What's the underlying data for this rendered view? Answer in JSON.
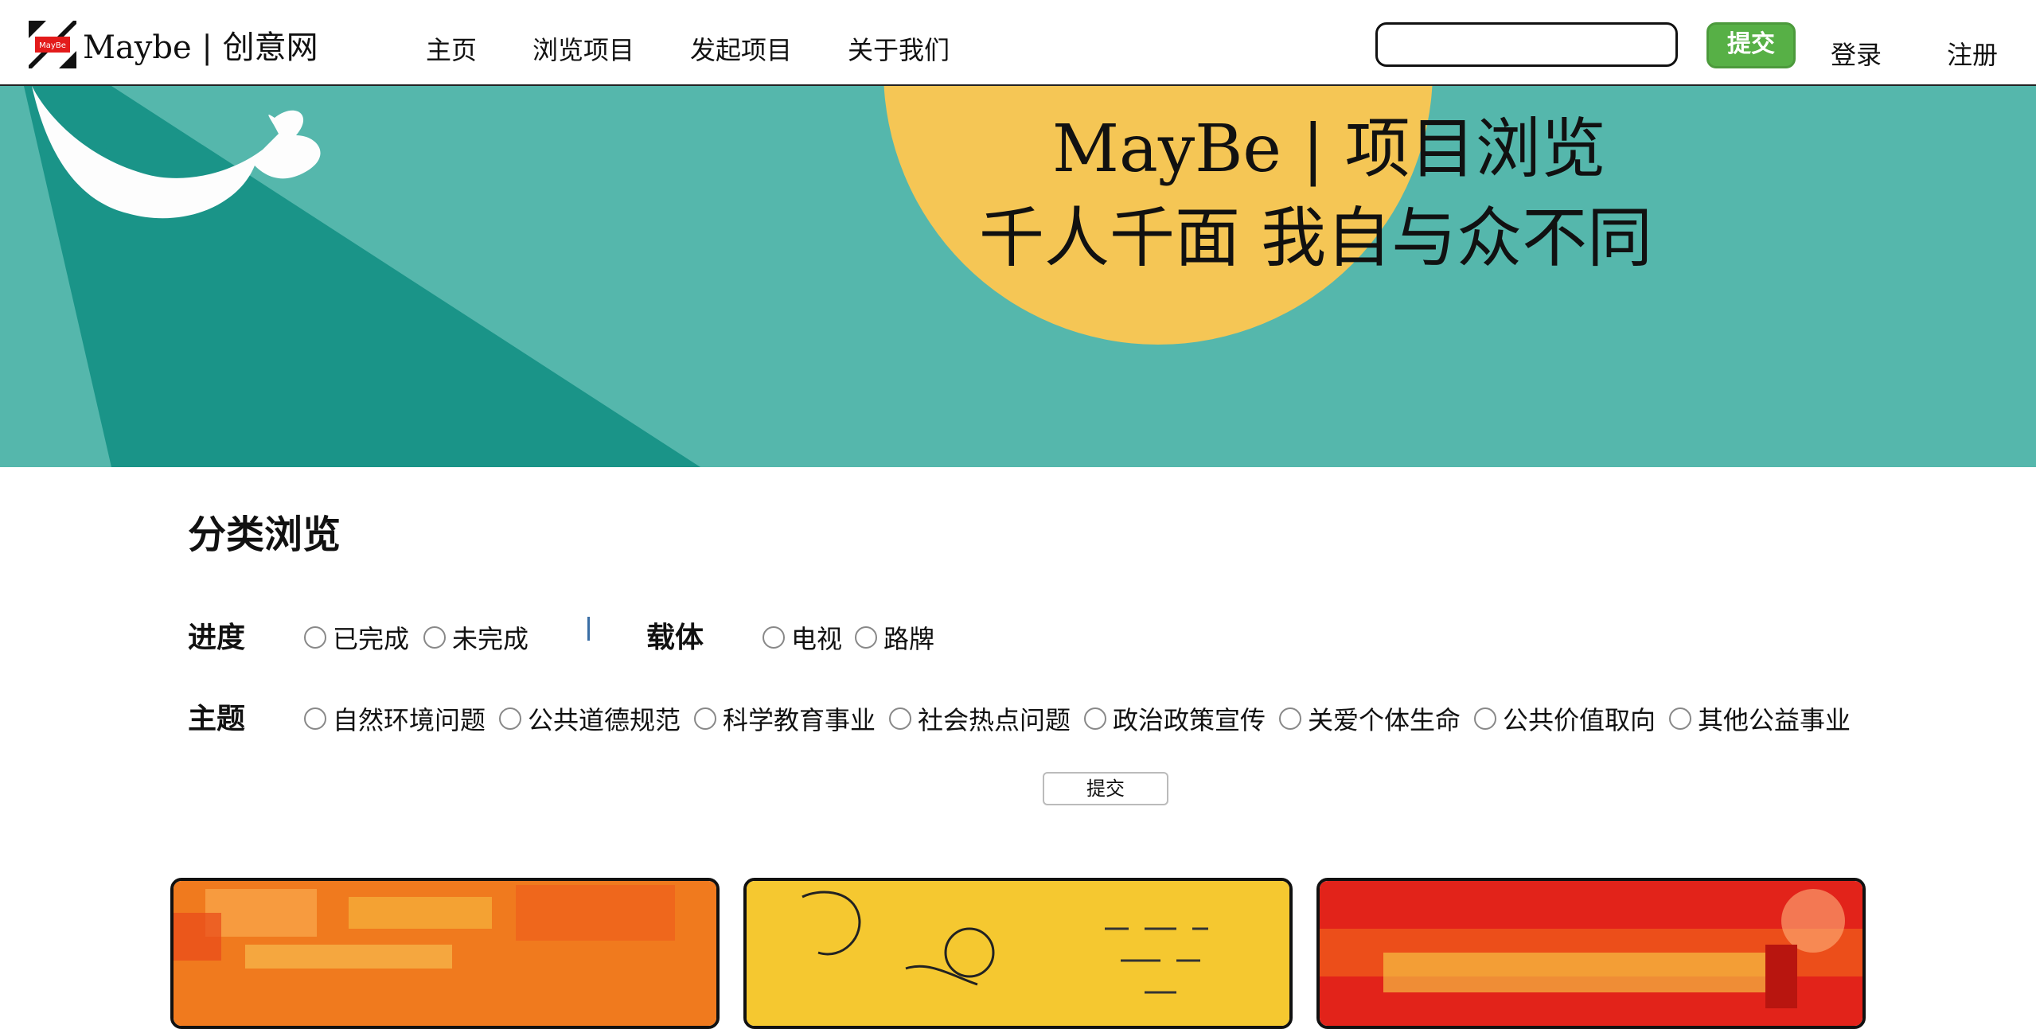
{
  "header": {
    "logo_badge": "MayBe",
    "logo_text": "Maybe | 创意网",
    "nav": [
      "主页",
      "浏览项目",
      "发起项目",
      "关于我们"
    ],
    "search": {
      "value": "",
      "placeholder": ""
    },
    "submit_label": "提交",
    "login_label": "登录",
    "register_label": "注册"
  },
  "banner": {
    "title": "MayBe | 项目浏览",
    "subtitle": "千人千面 我自与众不同"
  },
  "filters": {
    "section_title": "分类浏览",
    "progress": {
      "label": "进度",
      "options": [
        "已完成",
        "未完成"
      ]
    },
    "carrier": {
      "label": "载体",
      "options": [
        "电视",
        "路牌"
      ]
    },
    "topic": {
      "label": "主题",
      "options": [
        "自然环境问题",
        "公共道德规范",
        "科学教育事业",
        "社会热点问题",
        "政治政策宣传",
        "关爱个体生命",
        "公共价值取向",
        "其他公益事业"
      ]
    },
    "submit_label": "提交"
  },
  "colors": {
    "banner_teal": "#55b7ac",
    "banner_dark_teal": "#1a9488",
    "banner_sun": "#f5c655",
    "submit_green": "#57b046"
  }
}
